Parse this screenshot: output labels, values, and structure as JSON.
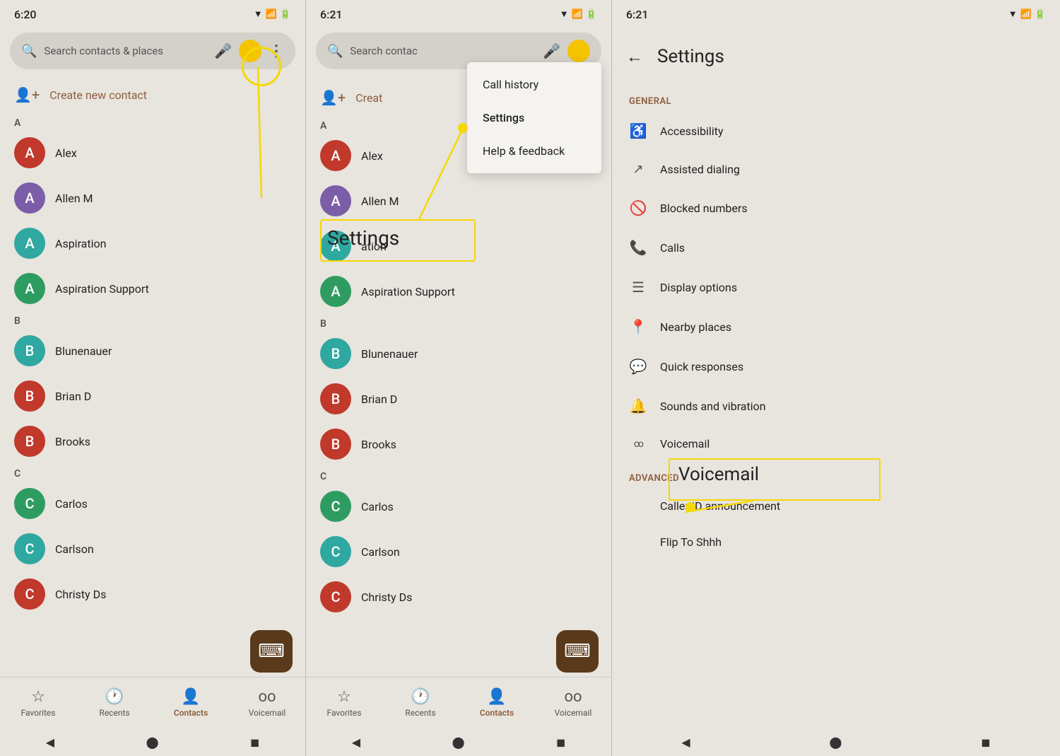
{
  "panel1": {
    "status": {
      "time": "6:20",
      "icons": "▼◀ 📶 🔋"
    },
    "search": {
      "placeholder": "Search contacts & places"
    },
    "create_contact": "Create new contact",
    "contacts": [
      {
        "letter": "A",
        "items": [
          {
            "name": "Alex",
            "initial": "A",
            "color": "av-red"
          },
          {
            "name": "Allen M",
            "initial": "A",
            "color": "av-purple"
          },
          {
            "name": "Aspiration",
            "initial": "A",
            "color": "av-teal"
          },
          {
            "name": "Aspiration Support",
            "initial": "A",
            "color": "av-green"
          }
        ]
      },
      {
        "letter": "B",
        "items": [
          {
            "name": "Blunenauer",
            "initial": "B",
            "color": "av-teal"
          },
          {
            "name": "Brian D",
            "initial": "B",
            "color": "av-red"
          },
          {
            "name": "Brooks",
            "initial": "B",
            "color": "av-red"
          }
        ]
      },
      {
        "letter": "C",
        "items": [
          {
            "name": "Carlos",
            "initial": "C",
            "color": "av-green"
          },
          {
            "name": "Carlson",
            "initial": "C",
            "color": "av-teal"
          },
          {
            "name": "Christy Ds",
            "initial": "C",
            "color": "av-red"
          }
        ]
      }
    ],
    "nav": [
      {
        "label": "Favorites",
        "icon": "☆",
        "active": false
      },
      {
        "label": "Recents",
        "icon": "🕐",
        "active": false
      },
      {
        "label": "Contacts",
        "icon": "👤",
        "active": true
      },
      {
        "label": "Voicemail",
        "icon": "oo",
        "active": false
      }
    ]
  },
  "panel2": {
    "status": {
      "time": "6:21"
    },
    "search": {
      "placeholder": "Search contac"
    },
    "dropdown": {
      "items": [
        "Call history",
        "Settings",
        "Help & feedback"
      ]
    },
    "annotation_label": "Settings",
    "create_contact": "Creat",
    "contacts": [
      {
        "letter": "A",
        "items": [
          {
            "name": "Alex",
            "initial": "A",
            "color": "av-red"
          },
          {
            "name": "Allen M",
            "initial": "A",
            "color": "av-purple"
          },
          {
            "name": "ation",
            "initial": "A",
            "color": "av-teal"
          },
          {
            "name": "Aspiration Support",
            "initial": "A",
            "color": "av-green"
          }
        ]
      },
      {
        "letter": "B",
        "items": [
          {
            "name": "Blunenauer",
            "initial": "B",
            "color": "av-teal"
          },
          {
            "name": "Brian D",
            "initial": "B",
            "color": "av-red"
          },
          {
            "name": "Brooks",
            "initial": "B",
            "color": "av-red"
          }
        ]
      },
      {
        "letter": "C",
        "items": [
          {
            "name": "Carlos",
            "initial": "C",
            "color": "av-green"
          },
          {
            "name": "Carlson",
            "initial": "C",
            "color": "av-teal"
          },
          {
            "name": "Christy Ds",
            "initial": "C",
            "color": "av-red"
          }
        ]
      }
    ],
    "nav": [
      {
        "label": "Favorites",
        "icon": "☆",
        "active": false
      },
      {
        "label": "Recents",
        "icon": "🕐",
        "active": false
      },
      {
        "label": "Contacts",
        "icon": "👤",
        "active": true
      },
      {
        "label": "Voicemail",
        "icon": "oo",
        "active": false
      }
    ]
  },
  "panel3": {
    "status": {
      "time": "6:21"
    },
    "title": "Settings",
    "sections": [
      {
        "label": "GENERAL",
        "items": [
          {
            "icon": "♿",
            "label": "Accessibility"
          },
          {
            "icon": "",
            "label": "Assisted dialing"
          },
          {
            "icon": "🚫",
            "label": "Blocked numbers"
          },
          {
            "icon": "📞",
            "label": "Calls"
          },
          {
            "icon": "☰",
            "label": "Display options"
          },
          {
            "icon": "📍",
            "label": "Nearby places"
          },
          {
            "icon": "💬",
            "label": "Quick responses"
          },
          {
            "icon": "🔔",
            "label": "Sounds and vibration"
          },
          {
            "icon": "oo",
            "label": "Voicemail"
          }
        ]
      },
      {
        "label": "ADVANCED",
        "items": [
          {
            "icon": "",
            "label": "Caller ID announcement"
          },
          {
            "icon": "",
            "label": "Flip To Shhh"
          }
        ]
      }
    ],
    "voicemail_annotation": "Voicemail",
    "advanced_annotation": "ADVANCED\nCaller ID announcement"
  }
}
